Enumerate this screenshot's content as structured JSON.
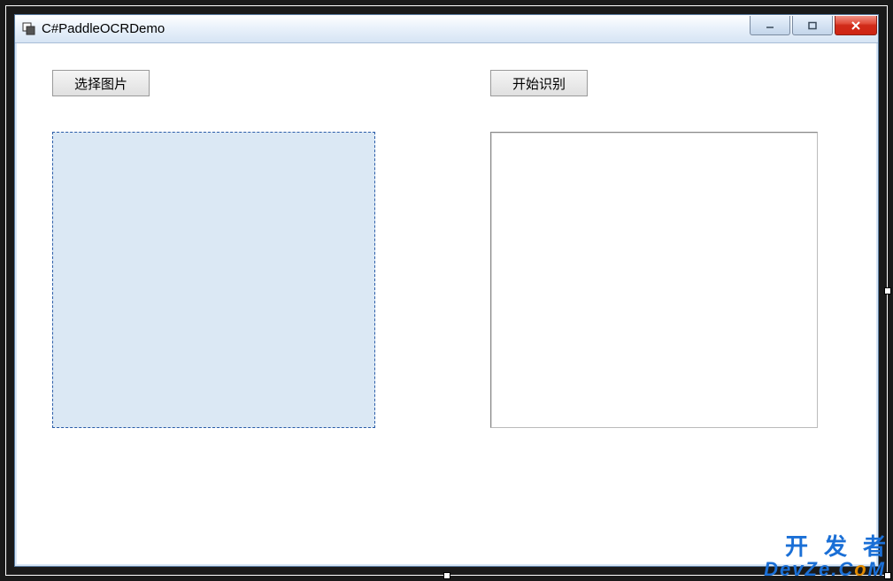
{
  "window": {
    "title": "C#PaddleOCRDemo"
  },
  "buttons": {
    "select_image": "选择图片",
    "start_recognize": "开始识别"
  },
  "watermark": {
    "line1": "开发者",
    "line2_plain": "DevZe.C",
    "line2_o": "o",
    "line2_m": "M"
  }
}
